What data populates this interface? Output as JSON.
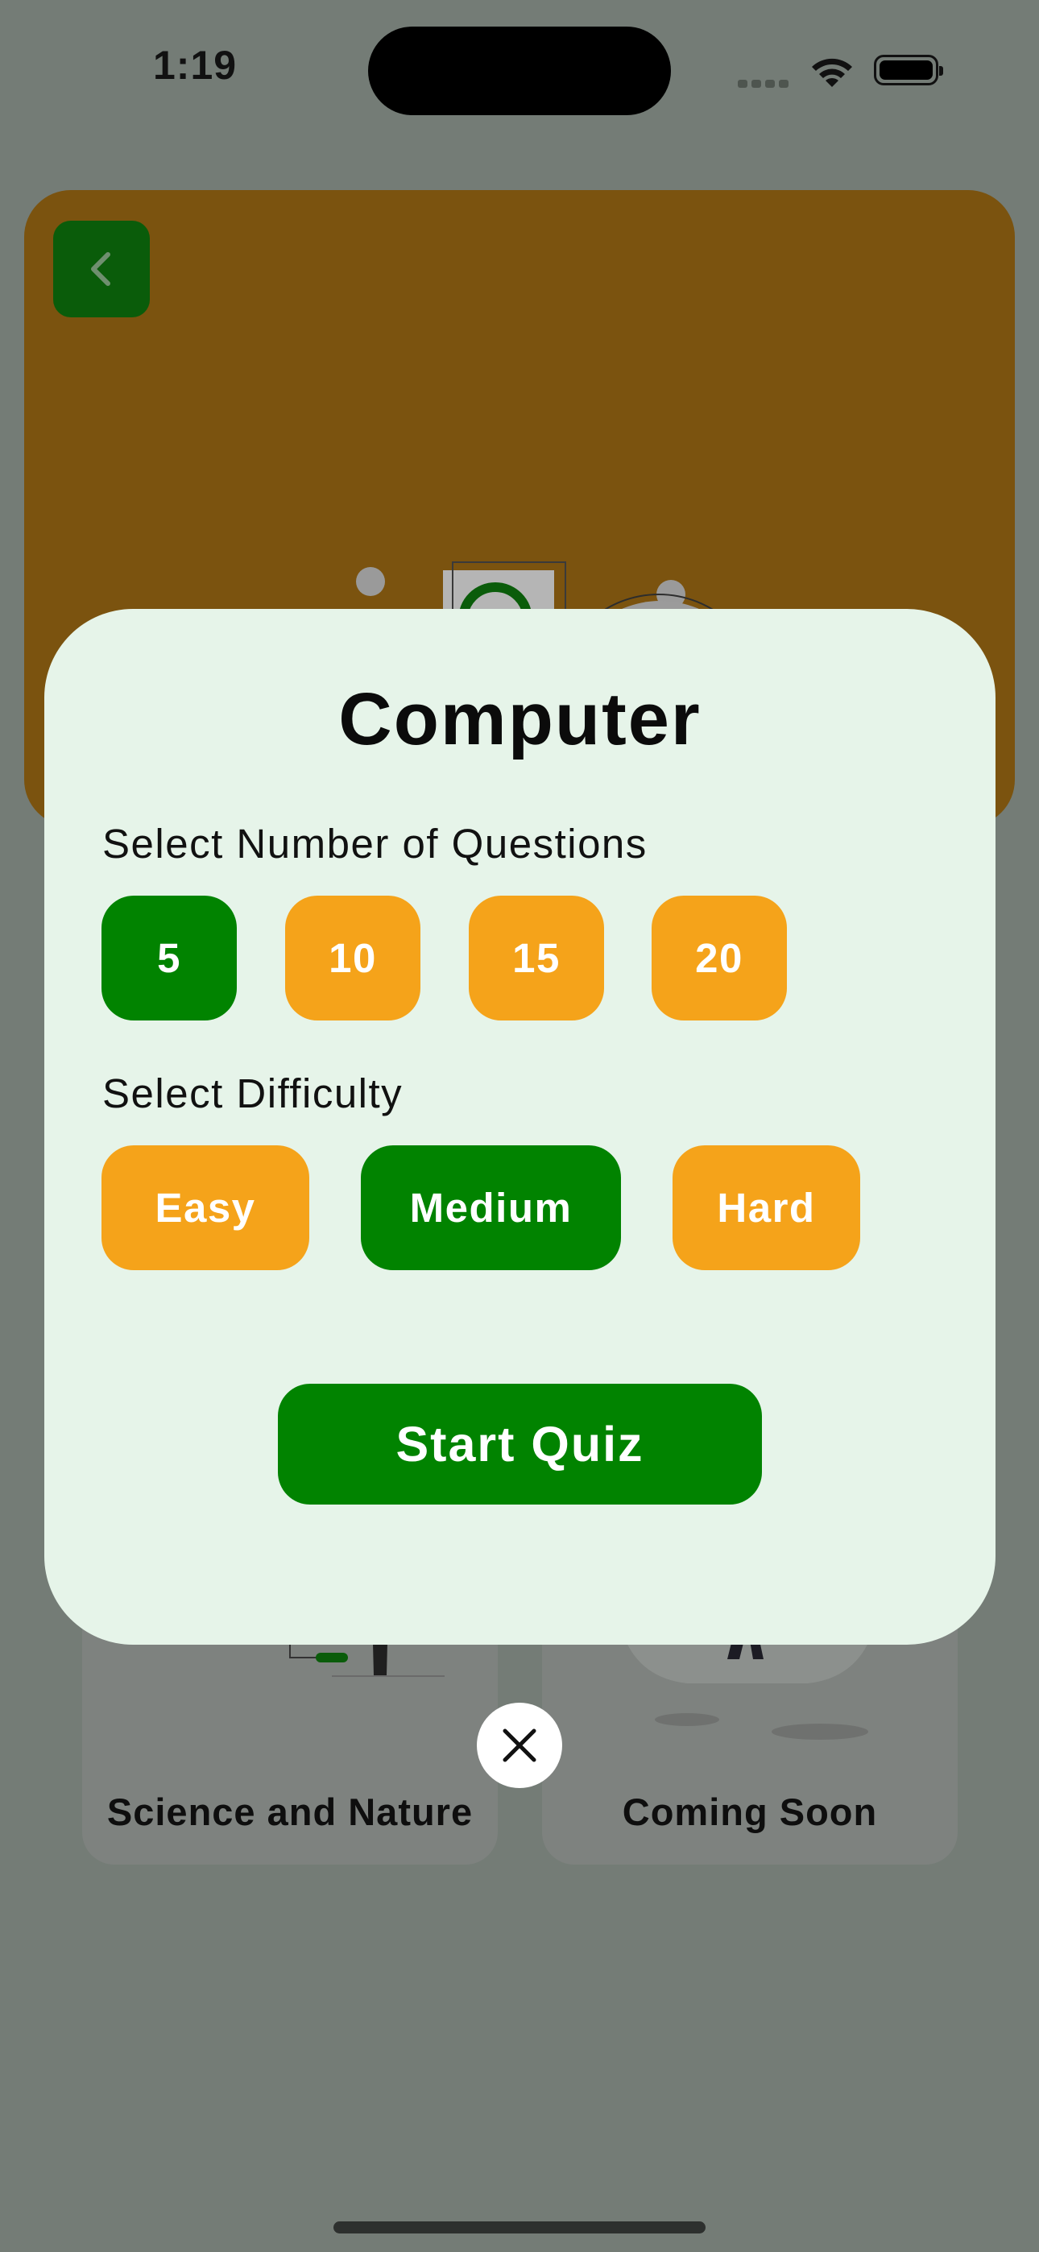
{
  "status_bar": {
    "time": "1:19"
  },
  "hero": {
    "back_icon": "chevron-left-icon"
  },
  "background_cards": [
    {
      "label": "Science and Nature"
    },
    {
      "label": "Coming Soon"
    }
  ],
  "modal": {
    "title": "Computer",
    "questions_label": "Select Number of Questions",
    "question_options": [
      {
        "label": "5",
        "selected": true
      },
      {
        "label": "10",
        "selected": false
      },
      {
        "label": "15",
        "selected": false
      },
      {
        "label": "20",
        "selected": false
      }
    ],
    "difficulty_label": "Select Difficulty",
    "difficulty_options": [
      {
        "label": "Easy",
        "selected": false
      },
      {
        "label": "Medium",
        "selected": true
      },
      {
        "label": "Hard",
        "selected": false
      }
    ],
    "start_label": "Start Quiz",
    "close_icon": "close-icon"
  },
  "colors": {
    "selected": "#018300",
    "unselected": "#f5a31a",
    "modal_bg": "#e6f4e9",
    "hero_bg": "#7b530f",
    "overlay": "#747c76"
  }
}
